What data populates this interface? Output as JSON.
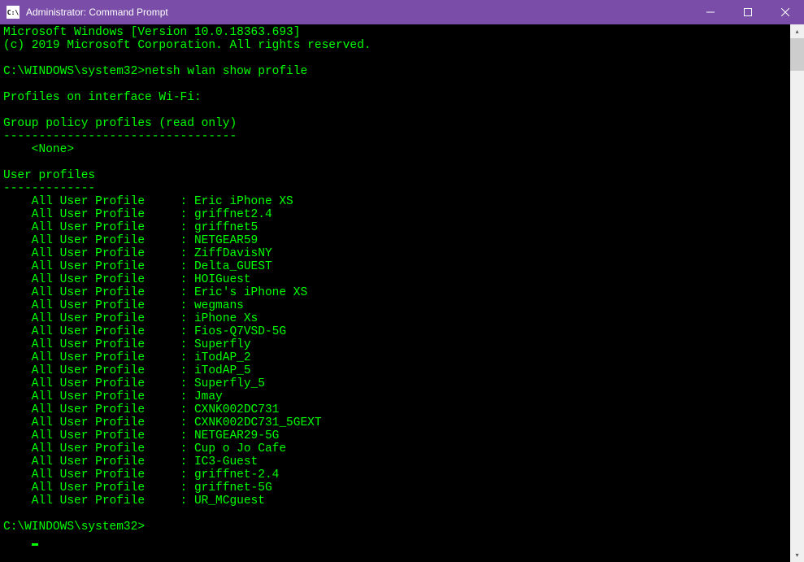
{
  "titlebar": {
    "icon_glyph": "C:\\",
    "title": "Administrator: Command Prompt"
  },
  "banner": {
    "line1": "Microsoft Windows [Version 10.0.18363.693]",
    "line2": "(c) 2019 Microsoft Corporation. All rights reserved."
  },
  "prompt1_path": "C:\\WINDOWS\\system32>",
  "prompt1_cmd": "netsh wlan show profile",
  "section_interface": "Profiles on interface Wi-Fi:",
  "group_policy_header": "Group policy profiles (read only)",
  "group_policy_sep": "---------------------------------",
  "group_policy_none": "    <None>",
  "user_profiles_header": "User profiles",
  "user_profiles_sep": "-------------",
  "profile_label": "    All User Profile     : ",
  "profiles": [
    "Eric iPhone XS",
    "griffnet2.4",
    "griffnet5",
    "NETGEAR59",
    "ZiffDavisNY",
    "Delta_GUEST",
    "HOIGuest",
    "Eric's iPhone XS",
    "wegmans",
    "iPhone Xs",
    "Fios-Q7VSD-5G",
    "Superfly",
    "iTodAP_2",
    "iTodAP_5",
    "Superfly_5",
    "Jmay",
    "CXNK002DC731",
    "CXNK002DC731_5GEXT",
    "NETGEAR29-5G",
    "Cup o Jo Cafe",
    "IC3-Guest",
    "griffnet-2.4",
    "griffnet-5G",
    "UR_MCguest"
  ],
  "prompt2_path": "C:\\WINDOWS\\system32>"
}
